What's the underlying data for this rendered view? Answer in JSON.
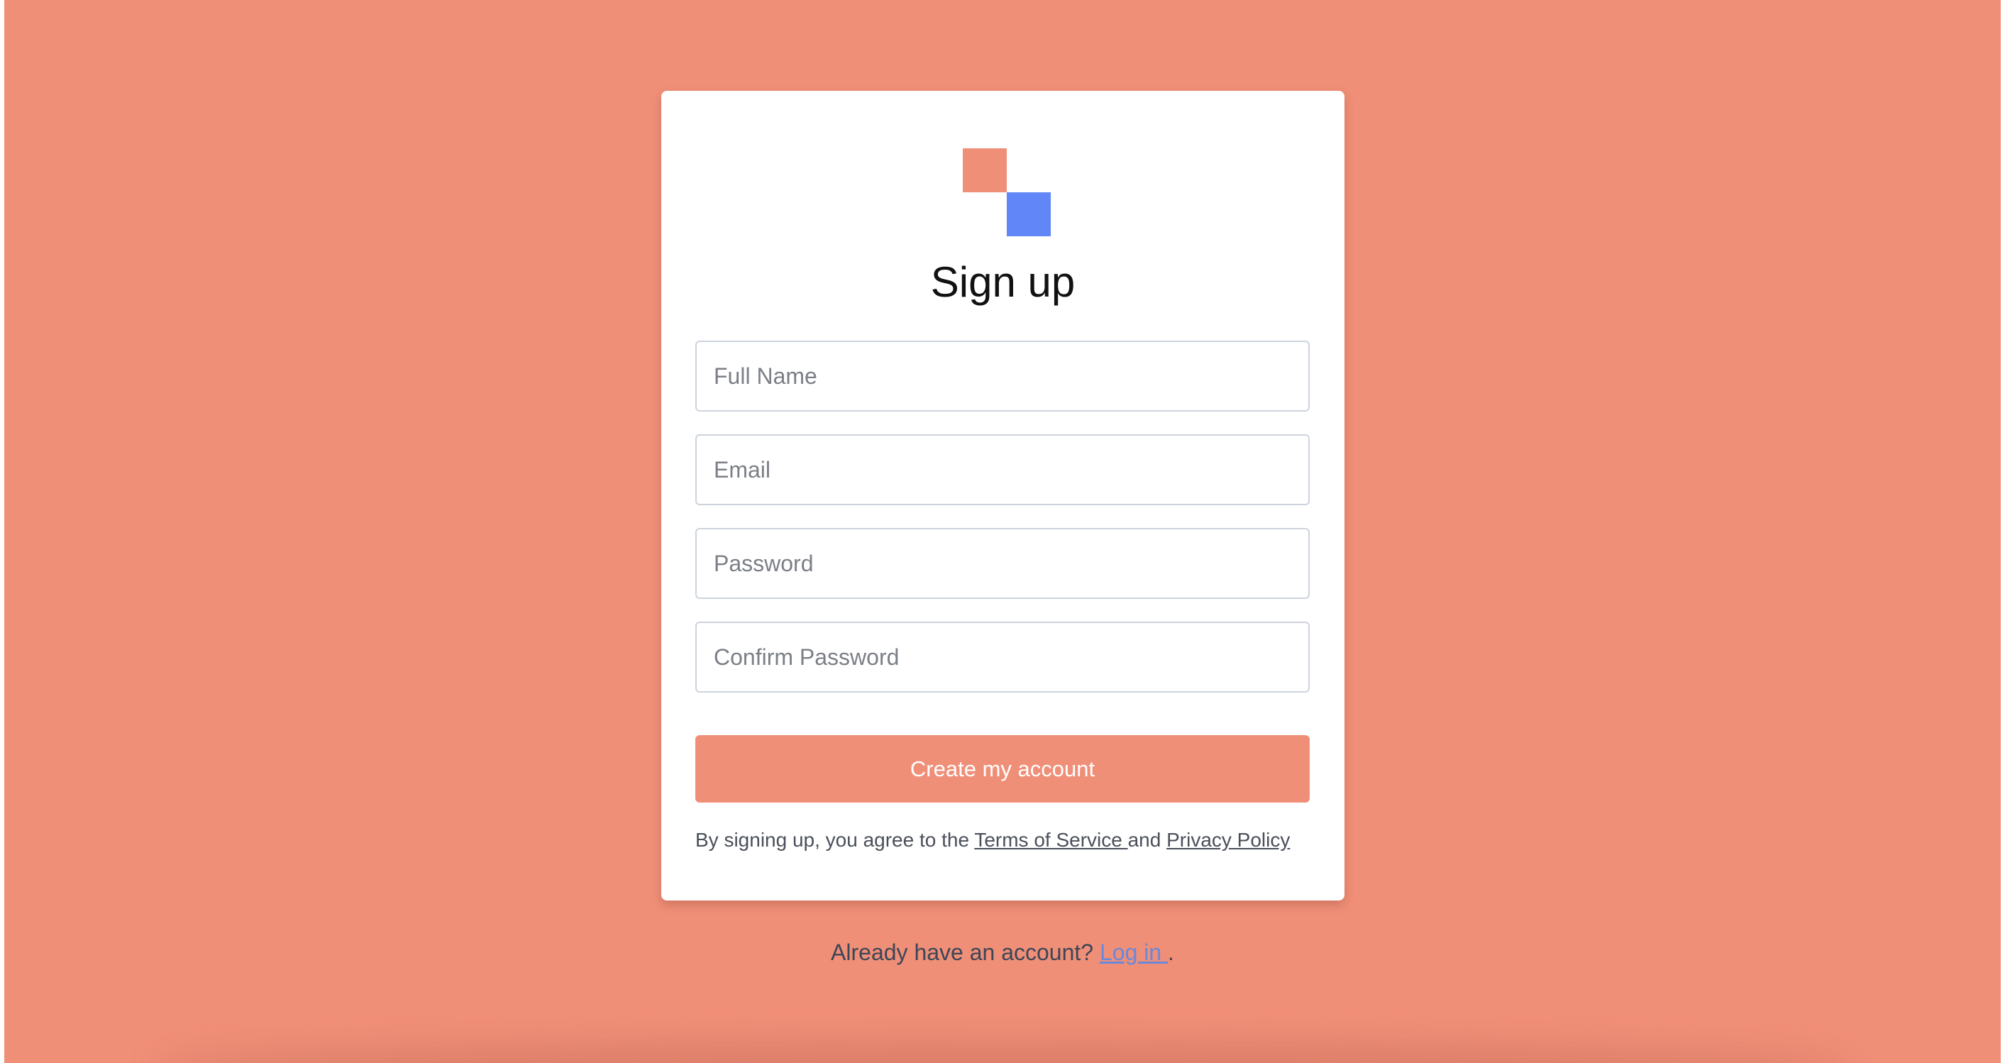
{
  "colors": {
    "background": "#f08f78",
    "accent": "#f08f78",
    "logo_secondary": "#6086f8",
    "link": "#6a88d8"
  },
  "logo": {
    "icon": "two-squares-logo-icon"
  },
  "form": {
    "title": "Sign up",
    "full_name": {
      "placeholder": "Full Name",
      "value": ""
    },
    "email": {
      "placeholder": "Email",
      "value": ""
    },
    "password": {
      "placeholder": "Password",
      "value": ""
    },
    "confirm_password": {
      "placeholder": "Confirm Password",
      "value": ""
    },
    "submit_label": "Create my account",
    "terms": {
      "prefix": "By signing up, you agree to the ",
      "terms_link": "Terms of Service ",
      "conjunction": "and ",
      "privacy_link": "Privacy Policy"
    }
  },
  "footer": {
    "prompt": "Already have an account? ",
    "login_link": "Log in ",
    "suffix": "."
  }
}
